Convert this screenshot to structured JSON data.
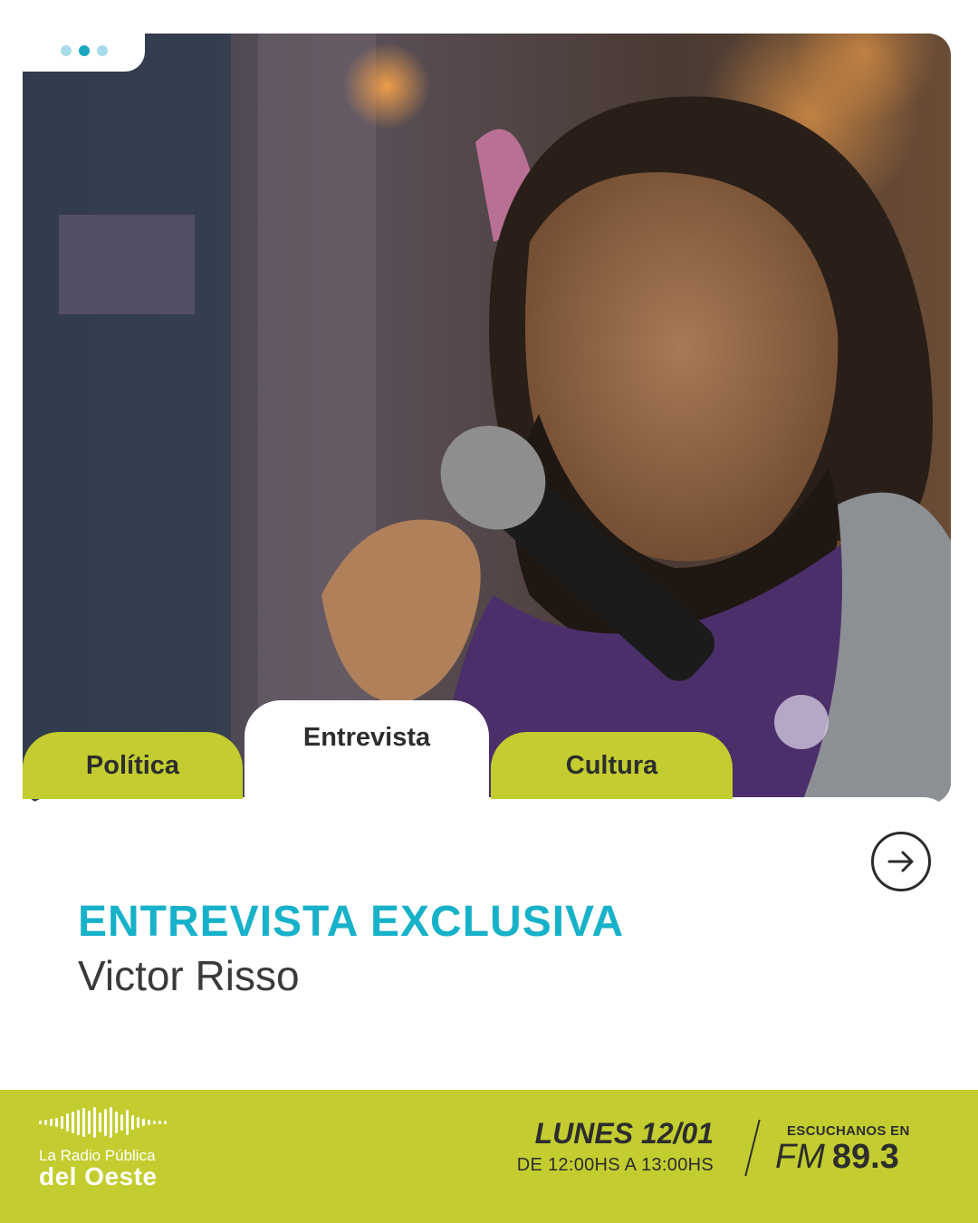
{
  "carousel": {
    "dots": [
      "#a9dcea",
      "#1aa6c0",
      "#a9dcea"
    ]
  },
  "tabs": {
    "left": "Política",
    "center": "Entrevista",
    "right": "Cultura"
  },
  "headline": "ENTREVISTA EXCLUSIVA",
  "guest": "Victor Risso",
  "footer": {
    "logo_line1": "La Radio Pública",
    "logo_line2": "del Oeste",
    "date": "LUNES 12/01",
    "time": "DE 12:00HS A 13:00HS",
    "listen_label": "ESCUCHANOS EN",
    "band": "FM",
    "frequency": "89.3"
  },
  "colors": {
    "accent_green": "#c3cd2f",
    "accent_cyan": "#17b1c9"
  }
}
